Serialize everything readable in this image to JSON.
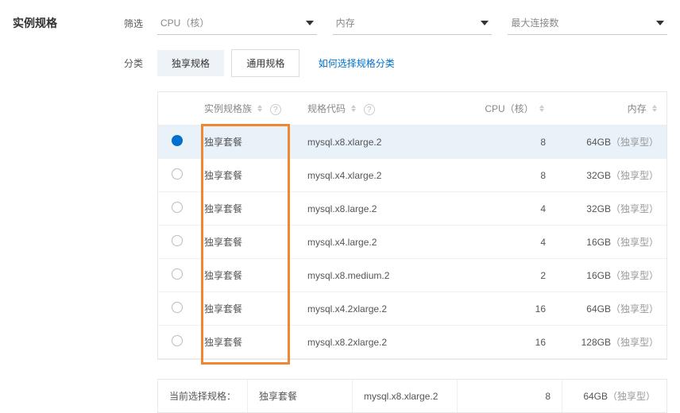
{
  "title": "实例规格",
  "filters": {
    "label": "筛选",
    "cpu": "CPU（核）",
    "memory": "内存",
    "max_conn": "最大连接数"
  },
  "classify": {
    "label": "分类",
    "tab_exclusive": "独享规格",
    "tab_general": "通用规格",
    "help_link": "如何选择规格分类"
  },
  "columns": {
    "family": "实例规格族",
    "code": "规格代码",
    "cpu": "CPU（核）",
    "memory": "内存"
  },
  "rows": [
    {
      "selected": true,
      "family": "独享套餐",
      "code": "mysql.x8.xlarge.2",
      "cpu": "8",
      "mem": "64GB",
      "mem_note": "（独享型）"
    },
    {
      "selected": false,
      "family": "独享套餐",
      "code": "mysql.x4.xlarge.2",
      "cpu": "8",
      "mem": "32GB",
      "mem_note": "（独享型）"
    },
    {
      "selected": false,
      "family": "独享套餐",
      "code": "mysql.x8.large.2",
      "cpu": "4",
      "mem": "32GB",
      "mem_note": "（独享型）"
    },
    {
      "selected": false,
      "family": "独享套餐",
      "code": "mysql.x4.large.2",
      "cpu": "4",
      "mem": "16GB",
      "mem_note": "（独享型）"
    },
    {
      "selected": false,
      "family": "独享套餐",
      "code": "mysql.x8.medium.2",
      "cpu": "2",
      "mem": "16GB",
      "mem_note": "（独享型）"
    },
    {
      "selected": false,
      "family": "独享套餐",
      "code": "mysql.x4.2xlarge.2",
      "cpu": "16",
      "mem": "64GB",
      "mem_note": "（独享型）"
    },
    {
      "selected": false,
      "family": "独享套餐",
      "code": "mysql.x8.2xlarge.2",
      "cpu": "16",
      "mem": "128GB",
      "mem_note": "（独享型）"
    }
  ],
  "summary": {
    "label": "当前选择规格：",
    "family": "独享套餐",
    "code": "mysql.x8.xlarge.2",
    "cpu": "8",
    "mem": "64GB",
    "mem_note": "（独享型）"
  }
}
